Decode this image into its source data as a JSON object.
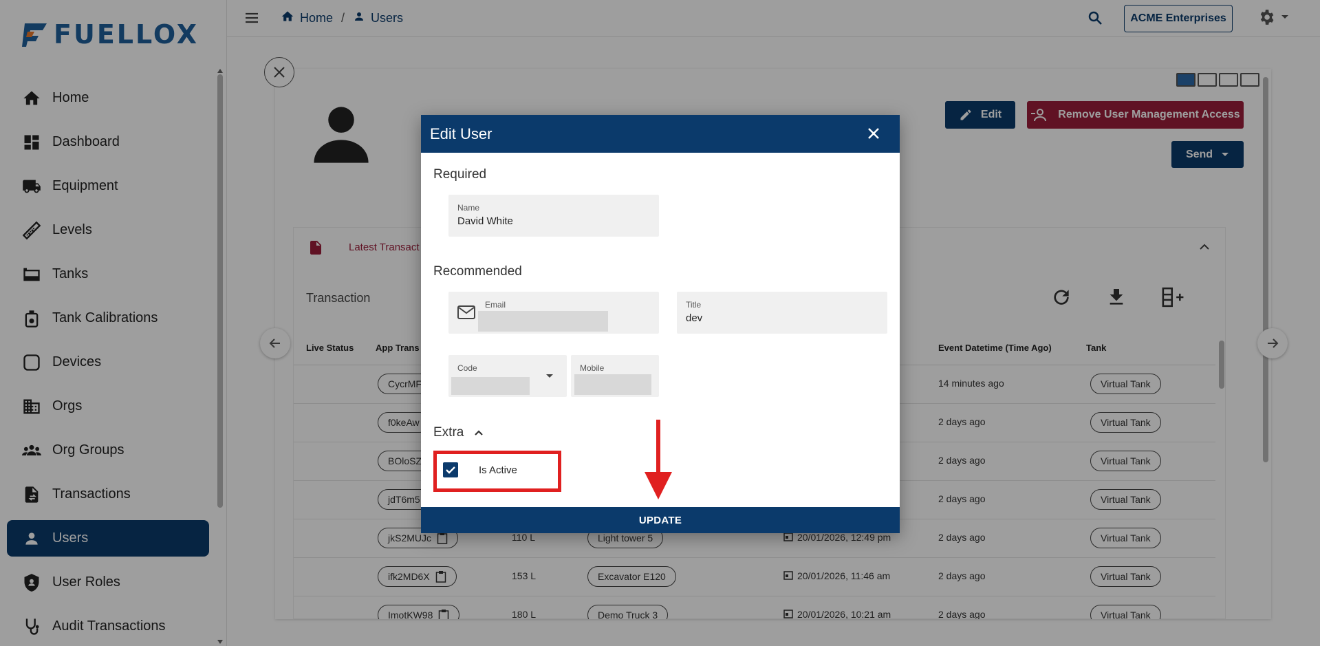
{
  "app": {
    "brand": "FUELLOX"
  },
  "sidebar": {
    "items": [
      {
        "label": "Home",
        "icon": "home-icon"
      },
      {
        "label": "Dashboard",
        "icon": "dashboard-icon"
      },
      {
        "label": "Equipment",
        "icon": "truck-icon"
      },
      {
        "label": "Levels",
        "icon": "ruler-icon"
      },
      {
        "label": "Tanks",
        "icon": "tank-icon"
      },
      {
        "label": "Tank Calibrations",
        "icon": "calibration-icon"
      },
      {
        "label": "Devices",
        "icon": "device-icon"
      },
      {
        "label": "Orgs",
        "icon": "building-icon"
      },
      {
        "label": "Org Groups",
        "icon": "groups-icon"
      },
      {
        "label": "Transactions",
        "icon": "transactions-icon"
      },
      {
        "label": "Users",
        "icon": "user-icon",
        "active": true
      },
      {
        "label": "User Roles",
        "icon": "shield-icon"
      },
      {
        "label": "Audit Transactions",
        "icon": "stethoscope-icon"
      }
    ]
  },
  "topbar": {
    "breadcrumb": [
      {
        "label": "Home"
      },
      {
        "label": "Users"
      }
    ],
    "org": "ACME Enterprises"
  },
  "profile": {
    "edit_label": "Edit",
    "remove_label": "Remove User Management Access",
    "send_label": "Send"
  },
  "transactions": {
    "tab_label": "Latest Transact",
    "title": "Transaction",
    "columns": {
      "live_status": "Live Status",
      "app_trans": "App Trans",
      "event_datetime": "Event Datetime (Time Ago)",
      "tank": "Tank"
    },
    "rows": [
      {
        "id": "CycrMF",
        "amount": "",
        "equipment": "",
        "date": "",
        "ago": "14 minutes ago",
        "tank": "Virtual Tank"
      },
      {
        "id": "f0keAw",
        "amount": "",
        "equipment": "",
        "date": "",
        "ago": "2 days ago",
        "tank": "Virtual Tank"
      },
      {
        "id": "BOloSZ",
        "amount": "",
        "equipment": "",
        "date": "",
        "ago": "2 days ago",
        "tank": "Virtual Tank"
      },
      {
        "id": "jdT6m5",
        "amount": "",
        "equipment": "",
        "date": "",
        "ago": "2 days ago",
        "tank": "Virtual Tank"
      },
      {
        "id": "jkS2MUJc",
        "amount": "110 L",
        "equipment": "Light tower 5",
        "date": "20/01/2026, 12:49 pm",
        "ago": "2 days ago",
        "tank": "Virtual Tank"
      },
      {
        "id": "ifk2MD6X",
        "amount": "153 L",
        "equipment": "Excavator E120",
        "date": "20/01/2026, 11:46 am",
        "ago": "2 days ago",
        "tank": "Virtual Tank"
      },
      {
        "id": "ImotKW98",
        "amount": "180 L",
        "equipment": "Demo Truck 3",
        "date": "20/01/2026, 10:21 am",
        "ago": "2 days ago",
        "tank": "Virtual Tank"
      }
    ]
  },
  "modal": {
    "title": "Edit User",
    "required_label": "Required",
    "name_label": "Name",
    "name_value": "David White",
    "recommended_label": "Recommended",
    "email_label": "Email",
    "title_label": "Title",
    "title_value": "dev",
    "code_label": "Code",
    "mobile_label": "Mobile",
    "extra_label": "Extra",
    "is_active_label": "Is Active",
    "is_active_checked": true,
    "update_label": "UPDATE"
  },
  "colors": {
    "primary": "#0b3a6b",
    "danger": "#9c1d3a",
    "highlight": "#e02020"
  }
}
